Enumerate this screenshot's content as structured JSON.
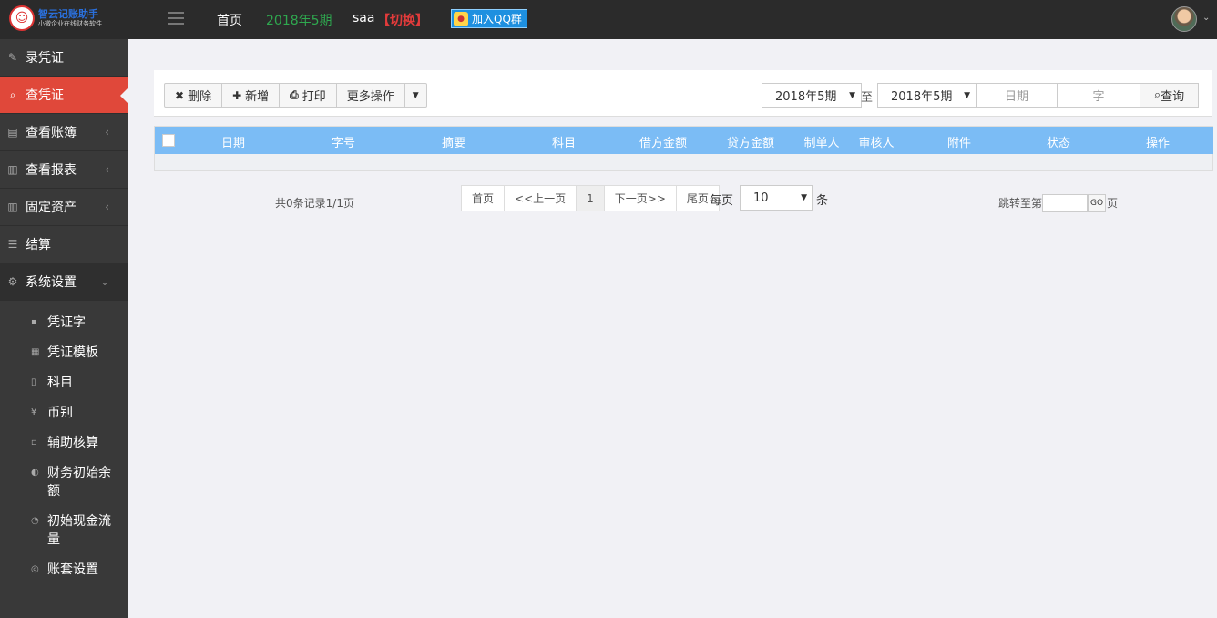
{
  "header": {
    "logo_title": "智云记账助手",
    "logo_subtitle": "小微企业在线财务软件",
    "home": "首页",
    "period": "2018年5期",
    "account": "saa",
    "switch": "【切换】",
    "qq_group": "加入QQ群"
  },
  "sidebar": {
    "items": [
      {
        "label": "录凭证",
        "icon": "edit-icon"
      },
      {
        "label": "查凭证",
        "icon": "search-icon"
      },
      {
        "label": "查看账簿",
        "icon": "book-icon"
      },
      {
        "label": "查看报表",
        "icon": "bar-chart-icon"
      },
      {
        "label": "固定资产",
        "icon": "bar-chart-icon"
      },
      {
        "label": "结算",
        "icon": "list-icon"
      },
      {
        "label": "系统设置",
        "icon": "gear-icon"
      }
    ],
    "sub_items": [
      {
        "label": "凭证字"
      },
      {
        "label": "凭证模板"
      },
      {
        "label": "科目"
      },
      {
        "label": "币别"
      },
      {
        "label": "辅助核算"
      },
      {
        "label": "财务初始余额"
      },
      {
        "label": "初始现金流量"
      },
      {
        "label": "账套设置"
      }
    ]
  },
  "toolbar": {
    "delete": "删除",
    "add": "新增",
    "print": "打印",
    "more": "更多操作"
  },
  "filter": {
    "from_period": "2018年5期",
    "to_label": "至",
    "to_period": "2018年5期",
    "date_placeholder": "日期",
    "word_placeholder": "字",
    "query": "查询"
  },
  "table": {
    "columns": [
      "日期",
      "字号",
      "摘要",
      "科目",
      "借方金额",
      "贷方金额",
      "制单人",
      "审核人",
      "附件",
      "状态",
      "操作"
    ],
    "rows": []
  },
  "pagination": {
    "total": "共0条记录1/1页",
    "first": "首页",
    "prev": "<<上一页",
    "current": "1",
    "next": "下一页>>",
    "last": "尾页",
    "per_page_label": "每页",
    "per_page_value": "10",
    "per_page_unit": "条",
    "jump_label": "跳转至第",
    "go": "GO",
    "jump_unit": "页"
  },
  "colors": {
    "topbar": "#2b2b2b",
    "sidebar": "#393939",
    "active": "#e0483a",
    "table_header": "#7bbcf5",
    "period_green": "#2fa84f",
    "switch_red": "#e23b3b"
  }
}
